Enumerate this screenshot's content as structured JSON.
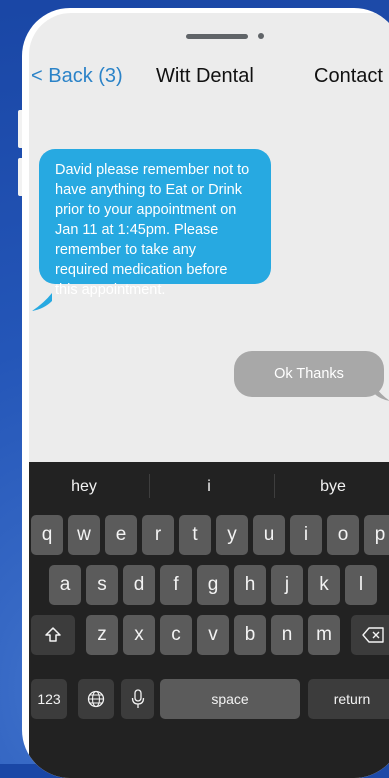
{
  "nav": {
    "back_label": "< Back (3)",
    "title": "Witt Dental",
    "contact_label": "Contact"
  },
  "messages": [
    {
      "direction": "incoming",
      "lines": [
        "David please remember not to",
        "have anything to Eat or Drink",
        "prior to your appointment on",
        "Jan 11 at 1:45pm. Please",
        "remember to take any",
        "required medication before",
        "this appointment."
      ],
      "color": "#27a9e1"
    },
    {
      "direction": "outgoing",
      "text": "Ok Thanks",
      "color": "#a8a8a8"
    }
  ],
  "keyboard": {
    "suggestions": [
      "hey",
      "i",
      "bye"
    ],
    "row1": [
      "q",
      "w",
      "e",
      "r",
      "t",
      "y",
      "u",
      "i",
      "o",
      "p"
    ],
    "row2": [
      "a",
      "s",
      "d",
      "f",
      "g",
      "h",
      "j",
      "k",
      "l"
    ],
    "row3": [
      "z",
      "x",
      "c",
      "v",
      "b",
      "n",
      "m"
    ],
    "numbers_label": "123",
    "space_label": "space",
    "return_label": "return",
    "icons": {
      "shift": "shift-icon",
      "delete": "delete-icon",
      "globe": "globe-icon",
      "mic": "microphone-icon"
    }
  },
  "colors": {
    "background": "#2456b8",
    "accent": "#2b83c8",
    "incoming_bubble": "#27a9e1",
    "outgoing_bubble": "#a8a8a8",
    "keyboard": "#222222",
    "key": "#5b5b5b"
  }
}
